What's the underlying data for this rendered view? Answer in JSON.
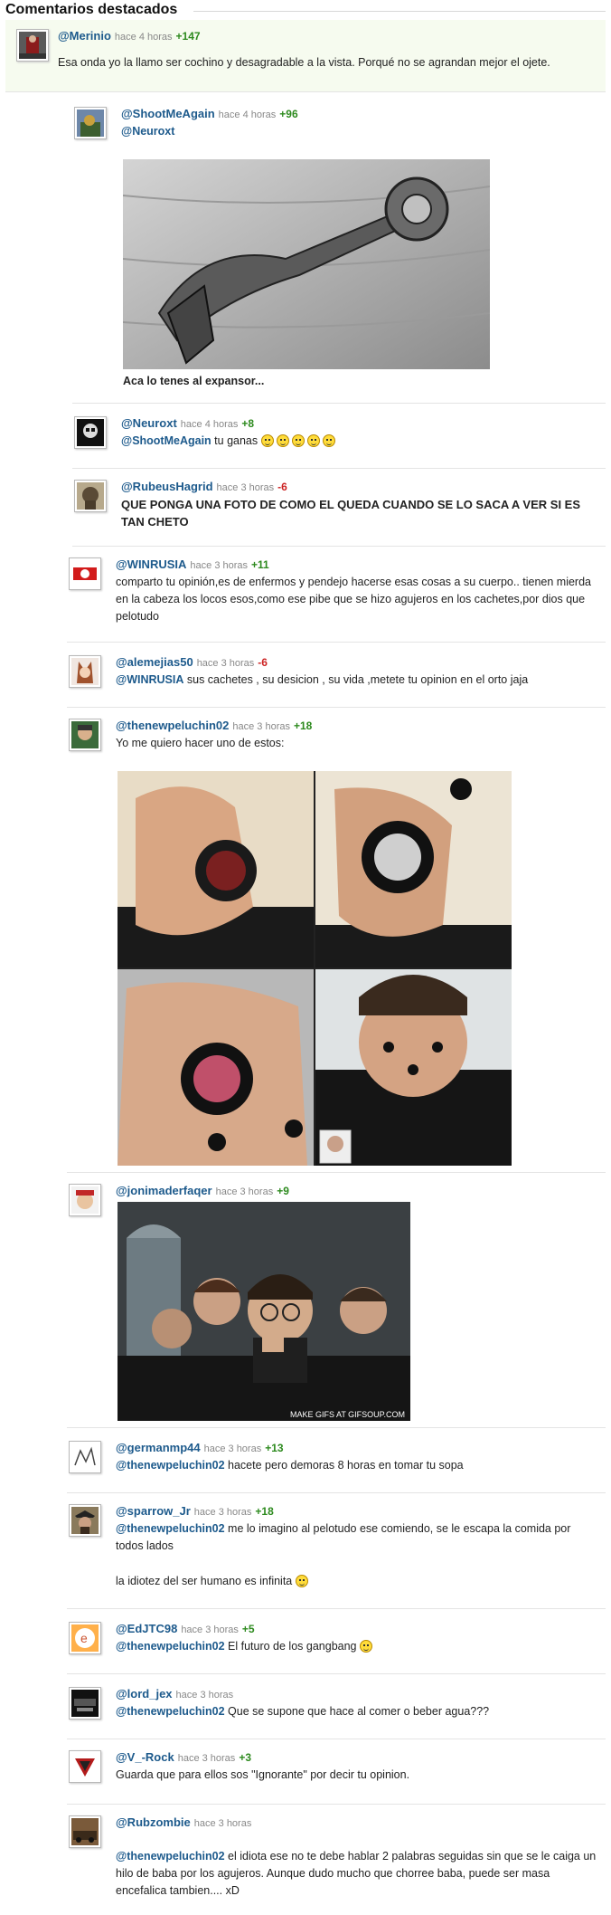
{
  "header": {
    "title": "Comentarios destacados"
  },
  "comments": [
    {
      "user": "@Merinio",
      "ago": "hace 4 horas",
      "score": "+147",
      "text": "Esa onda yo la llamo ser cochino y desagradable a la vista. Porqué no se agrandan mejor el ojete."
    },
    {
      "user": "@ShootMeAgain",
      "ago": "hace 4 horas",
      "score": "+96",
      "mention": "@Neuroxt",
      "caption": "Aca lo tenes al expansor..."
    },
    {
      "user": "@Neuroxt",
      "ago": "hace 4 horas",
      "score": "+8",
      "mention": "@ShootMeAgain",
      "text": "tu ganas"
    },
    {
      "user": "@RubeusHagrid",
      "ago": "hace 3 horas",
      "score": "-6",
      "text": "QUE PONGA UNA FOTO DE COMO EL QUEDA CUANDO SE LO SACA A VER SI ES TAN CHETO"
    },
    {
      "user": "@WINRUSIA",
      "ago": "hace 3 horas",
      "score": "+11",
      "text": "comparto tu opinión,es de enfermos y pendejo hacerse esas cosas a su cuerpo.. tienen mierda en la cabeza los locos esos,como ese pibe que se hizo agujeros en los cachetes,por dios que pelotudo"
    },
    {
      "user": "@alemejias50",
      "ago": "hace 3 horas",
      "score": "-6",
      "mention": "@WINRUSIA",
      "text": "sus cachetes , su desicion , su vida ,metete tu opinion en el orto jaja"
    },
    {
      "user": "@thenewpeluchin02",
      "ago": "hace 3 horas",
      "score": "+18",
      "text": "Yo me quiero hacer uno de estos:"
    },
    {
      "user": "@jonimaderfaqer",
      "ago": "hace 3 horas",
      "score": "+9",
      "gif_caption": "MAKE GIFS AT GIFSOUP.COM"
    },
    {
      "user": "@germanmp44",
      "ago": "hace 3 horas",
      "score": "+13",
      "mention": "@thenewpeluchin02",
      "text": "hacete pero demoras 8 horas en tomar tu sopa"
    },
    {
      "user": "@sparrow_Jr",
      "ago": "hace 3 horas",
      "score": "+18",
      "mention": "@thenewpeluchin02",
      "text": "me lo imagino al pelotudo ese comiendo, se le escapa la comida por todos lados",
      "text2": "la idiotez del ser humano es infinita"
    },
    {
      "user": "@EdJTC98",
      "ago": "hace 3 horas",
      "score": "+5",
      "mention": "@thenewpeluchin02",
      "text": "El futuro de los gangbang"
    },
    {
      "user": "@lord_jex",
      "ago": "hace 3 horas",
      "score": "",
      "mention": "@thenewpeluchin02",
      "text": "Que se supone que hace al comer o beber agua???"
    },
    {
      "user": "@V_-Rock",
      "ago": "hace 3 horas",
      "score": "+3",
      "text": "Guarda que para ellos sos \"Ignorante\" por decir tu opinion."
    },
    {
      "user": "@Rubzombie",
      "ago": "hace 3 horas",
      "score": "",
      "mention": "@thenewpeluchin02",
      "text": "el idiota ese no te debe hablar 2 palabras seguidas sin que se le caiga un hilo de baba por los agujeros. Aunque dudo mucho que chorree baba, puede ser masa encefalica tambien.... xD"
    }
  ],
  "colors": {
    "username": "#1d5a8c",
    "positive": "#2d8a1e",
    "negative": "#cc2222",
    "timestamp": "#888888"
  }
}
